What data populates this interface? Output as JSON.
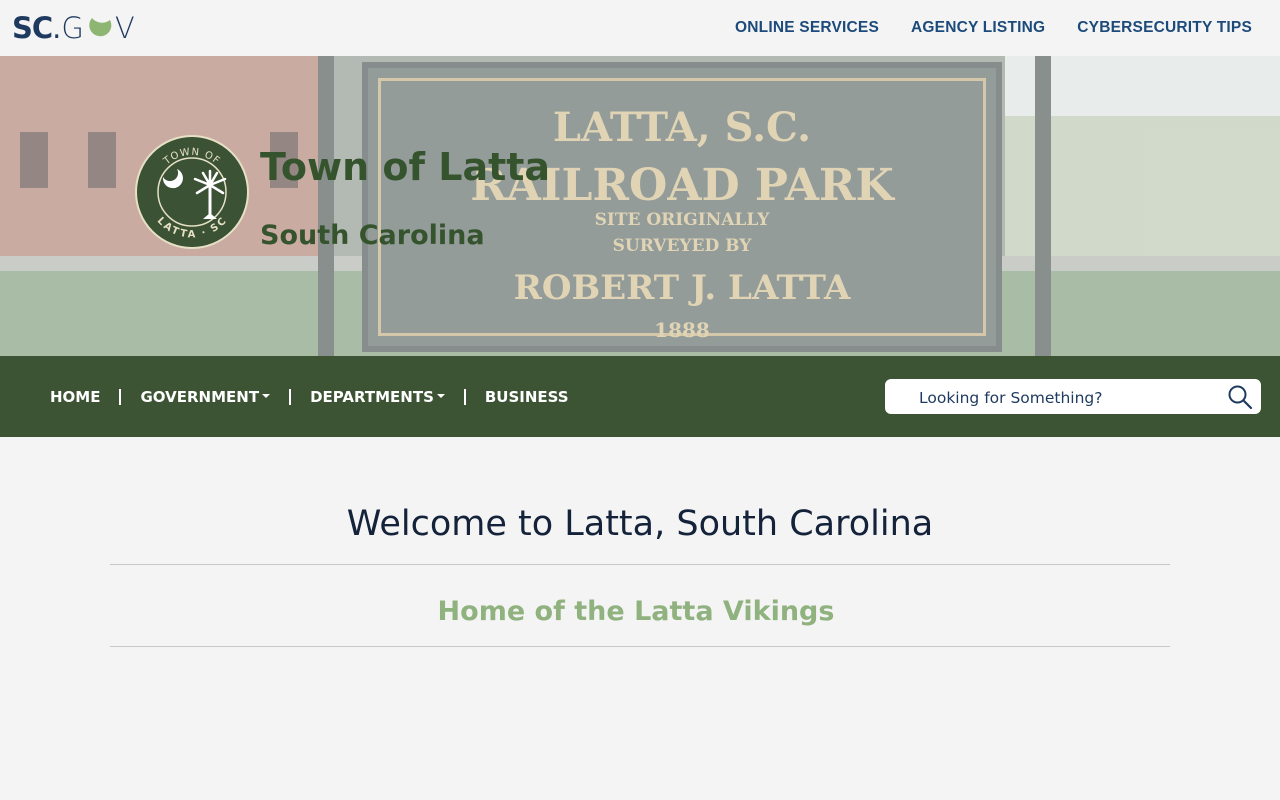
{
  "topbar": {
    "logo_text_sc": "SC",
    "logo_dot": ".",
    "logo_text_gov_g": "G",
    "logo_text_gov_v": "V",
    "links": [
      {
        "label": "ONLINE SERVICES"
      },
      {
        "label": "AGENCY LISTING"
      },
      {
        "label": "CYBERSECURITY TIPS"
      }
    ]
  },
  "hero": {
    "sign_lines": [
      "LATTA, S.C.",
      "RAILROAD PARK",
      "SITE ORIGINALLY",
      "SURVEYED BY",
      "ROBERT J. LATTA",
      "1888"
    ],
    "seal_top": "TOWN OF",
    "seal_bottom": "LATTA · SC",
    "title": "Town of Latta",
    "subtitle": "South Carolina"
  },
  "nav": {
    "items": [
      {
        "label": "HOME"
      },
      {
        "label": "GOVERNMENT"
      },
      {
        "label": "DEPARTMENTS"
      },
      {
        "label": "BUSINESS"
      }
    ],
    "search_placeholder": "Looking for Something?"
  },
  "main": {
    "welcome": "Welcome to Latta, South Carolina",
    "subheading": "Home of the Latta Vikings"
  },
  "colors": {
    "brand_navy": "#1f3a5f",
    "nav_green": "#3c5434",
    "title_green": "#35532d",
    "accent_green": "#8fb27f",
    "moon_green": "#8db673"
  }
}
